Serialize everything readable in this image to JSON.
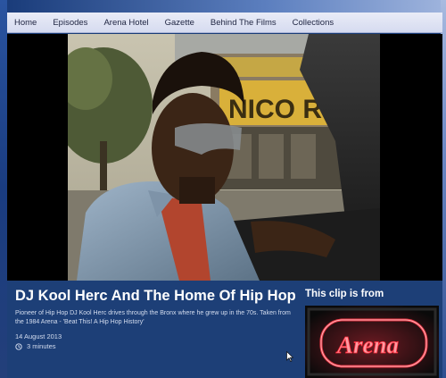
{
  "nav": {
    "items": [
      "Home",
      "Episodes",
      "Arena Hotel",
      "Gazette",
      "Behind The Films",
      "Collections"
    ]
  },
  "video": {
    "sign_text": "NICO RNITU"
  },
  "clip": {
    "title": "DJ Kool Herc And The Home Of Hip Hop",
    "description": "Pioneer of Hip Hop DJ Kool Herc drives through the Bronx where he grew up in the 70s. Taken from the 1984 Arena - 'Beat This! A Hip Hop History'",
    "date": "14 August 2013",
    "duration": "3 minutes"
  },
  "sidebar": {
    "heading": "This clip is from",
    "thumbnail_logo": "Arena"
  },
  "colors": {
    "accent": "#1d3f77",
    "nav_bg": "#e3e7f5",
    "neon": "#ff3b4a"
  }
}
